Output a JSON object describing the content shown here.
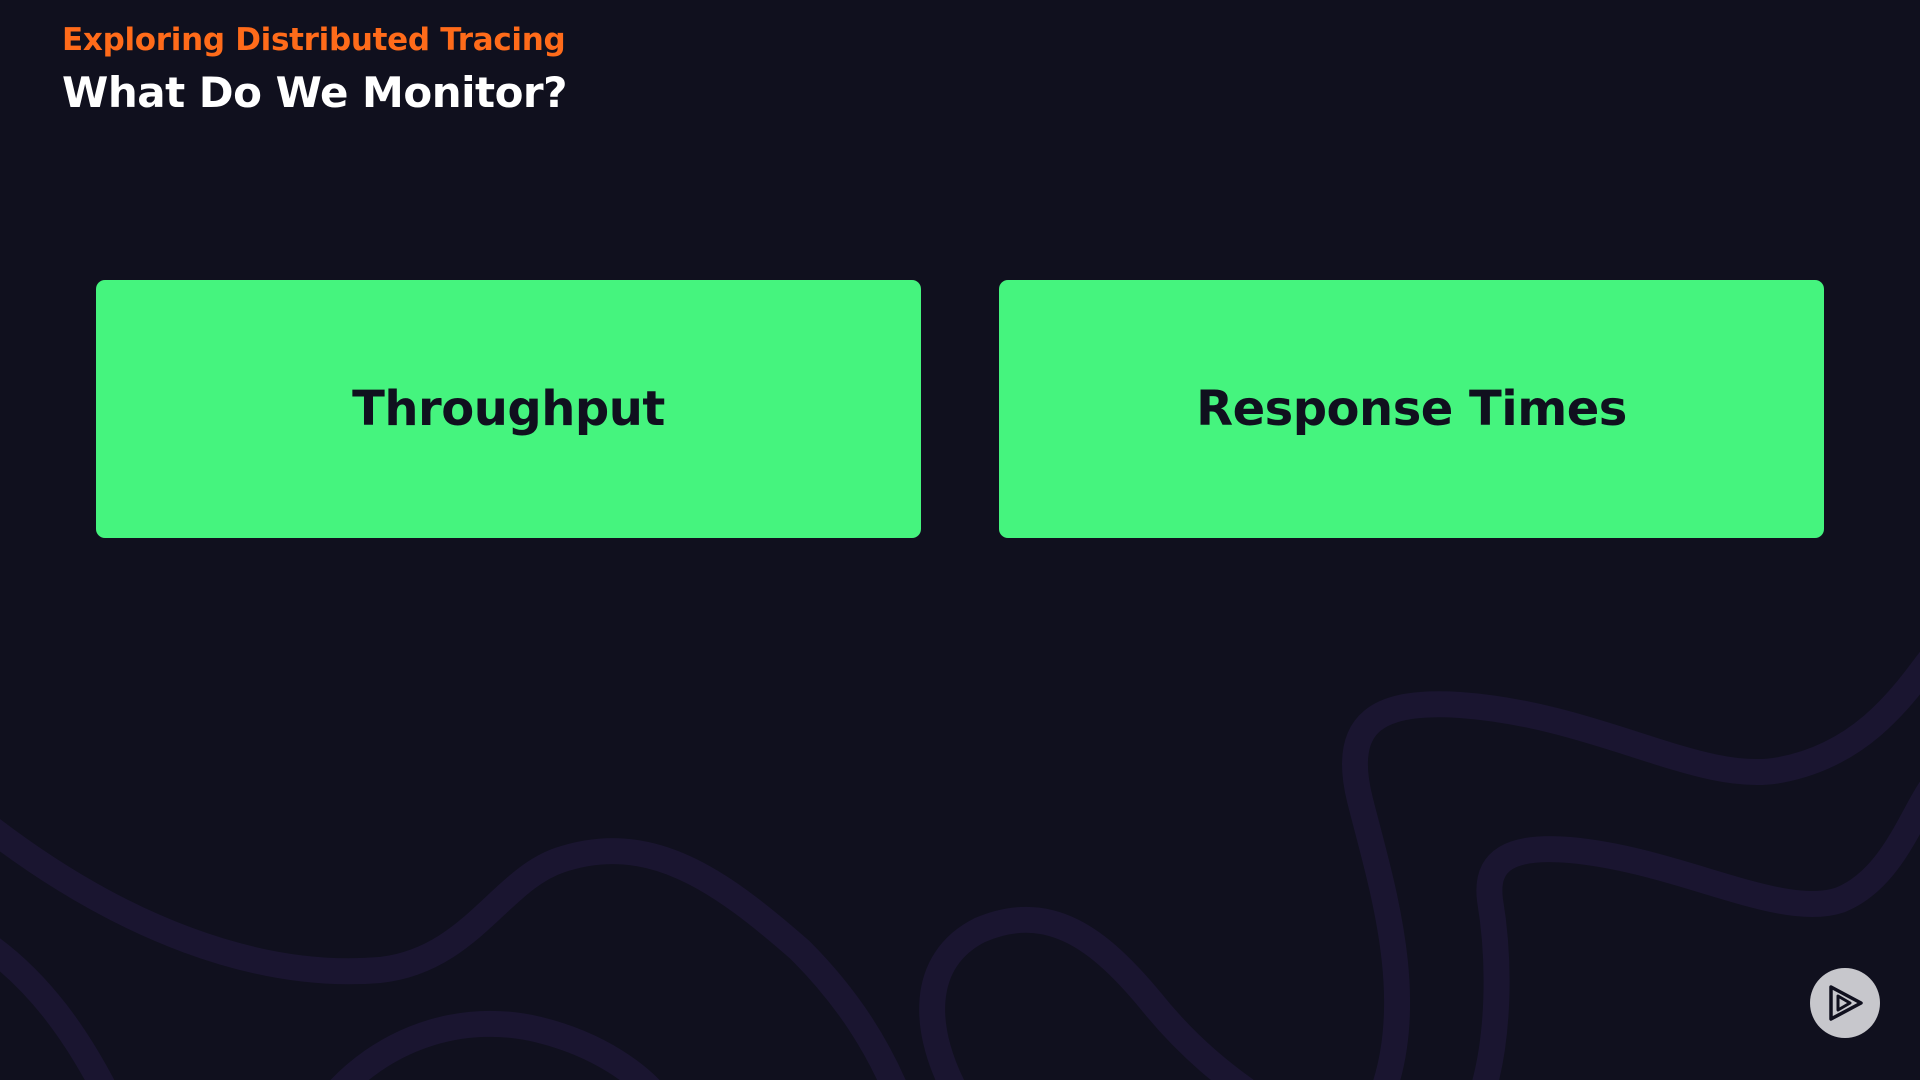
{
  "header": {
    "subtitle": "Exploring Distributed Tracing",
    "title": "What Do We Monitor?"
  },
  "cards": [
    {
      "label": "Throughput"
    },
    {
      "label": "Response Times"
    }
  ],
  "controls": {
    "play_icon": "play-logo-icon"
  },
  "colors": {
    "background": "#10101e",
    "accent_orange": "#ff6b1a",
    "card_green": "#45f47e",
    "card_text": "#10101e",
    "swirl": "#1a1530"
  }
}
